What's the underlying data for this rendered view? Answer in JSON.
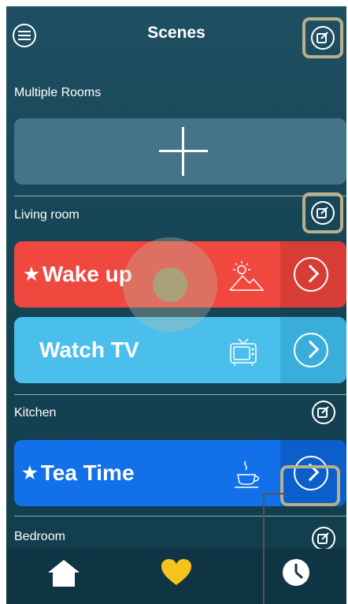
{
  "header": {
    "title": "Scenes"
  },
  "sections": [
    {
      "label": "Multiple Rooms"
    },
    {
      "label": "Living room"
    },
    {
      "label": "Kitchen"
    },
    {
      "label": "Bedroom"
    }
  ],
  "scenes": [
    {
      "name": "Wake up",
      "starred": true,
      "star": "★",
      "color": "#f0473e",
      "arrow_color": "#d83d35",
      "icon": "sunrise-mountain-icon"
    },
    {
      "name": "Watch TV",
      "starred": false,
      "star": "",
      "color": "#4bbfeb",
      "arrow_color": "#3aaedb",
      "icon": "tv-icon"
    },
    {
      "name": "Tea Time",
      "starred": true,
      "star": "★",
      "color": "#1271e8",
      "arrow_color": "#0c5fca",
      "icon": "teacup-icon"
    }
  ],
  "tabbar": {
    "items": [
      {
        "icon": "home-icon"
      },
      {
        "icon": "heart-icon",
        "color": "#f7c21b"
      },
      {
        "icon": "clock-icon"
      }
    ]
  },
  "colors": {
    "highlight": "#b7b08a",
    "add_card": "#43748a",
    "background": "#164556"
  }
}
